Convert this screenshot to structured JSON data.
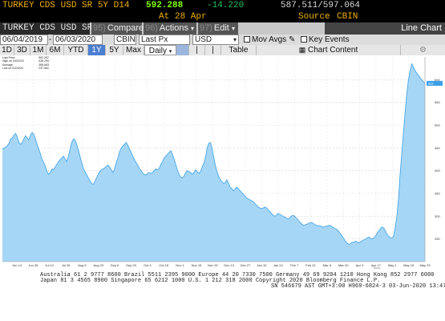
{
  "header": {
    "ticker": "TURKEY CDS USD SR 5Y D14",
    "price": "592.288",
    "change": "-14.220",
    "bid_ask": "587.511/597.064",
    "time_label": "At",
    "date": "28 Apr",
    "source_label": "Source",
    "source": "CBIN"
  },
  "toolbar": {
    "title": "TURKEY CDS USD SR",
    "compare_num": "95)",
    "compare_label": "Compare",
    "actions_num": "96)",
    "actions_label": "Actions",
    "edit_num": "97)",
    "edit_label": "Edit",
    "view_label": "Line Chart"
  },
  "fields": {
    "start_date": "06/04/2019",
    "end_date": "06/03/2020",
    "source_value": "CBIN",
    "price_type": "Last Px",
    "currency": "USD",
    "mov_avgs_label": "Mov Avgs",
    "key_events_label": "Key Events"
  },
  "periods": {
    "buttons": [
      "1D",
      "3D",
      "1M",
      "6M",
      "YTD",
      "1Y",
      "5Y",
      "Max"
    ],
    "selected": "1Y",
    "frequency": "Daily",
    "table_label": "Table",
    "chart_content_label": "Chart Content"
  },
  "legend": {
    "lines": [
      "Last Price",
      "High on 04/22/20",
      "Average",
      "Low on 01/24/20"
    ],
    "values": [
      "592.287",
      "635.294",
      "355.663",
      "237.661"
    ]
  },
  "footer": {
    "line1": "Australia 61 2 9777 8600 Brazil 5511 2395 9000 Europe 44 20 7330 7500 Germany 49 69 9204 1210 Hong Kong 852 2977 6000",
    "line2": "Japan 81 3 4565 8900      Singapore 65 6212 1000      U.S. 1 212 318 2000      Copyright 2020 Bloomberg Finance L.P.",
    "line3": "SN 546679 AST  GMT+3:00 H969-6824-3 03-Jun-2020 13:47:39"
  },
  "colors": {
    "price_up": "#7fff00",
    "price_down": "#20c060",
    "selected_period": "#4a7fd0",
    "area_fill": "#a6d6f5",
    "area_line": "#3aa0e6"
  },
  "chart_data": {
    "type": "area",
    "title": "",
    "xlabel": "",
    "ylabel": "",
    "ylim": [
      200,
      650
    ],
    "yticks": [
      250,
      300,
      350,
      400,
      450,
      500,
      550,
      600
    ],
    "xticks": [
      "Jun 14",
      "Jun 28",
      "Jul 12",
      "Jul 26",
      "Aug 9",
      "Aug 23",
      "Sep 6",
      "Sep 20",
      "Oct 4",
      "Oct 18",
      "Nov 1",
      "Nov 15",
      "Nov 29",
      "Dec 13",
      "Dec 27",
      "Jan 10",
      "Jan 24",
      "Feb 7",
      "Feb 21",
      "Mar 6",
      "Mar 20",
      "Apr 3",
      "Apr 17",
      "May 1",
      "May 15",
      "May 29"
    ],
    "grid": true,
    "series": [
      {
        "values": [
          447,
          450,
          452,
          455,
          460,
          470,
          472,
          478,
          482,
          474,
          462,
          458,
          462,
          470,
          477,
          472,
          468,
          478,
          484,
          480,
          470,
          458,
          448,
          438,
          425,
          418,
          410,
          398,
          392,
          396,
          404,
          402,
          408,
          414,
          420,
          424,
          428,
          432,
          426,
          420,
          432,
          448,
          462,
          470,
          468,
          458,
          446,
          432,
          418,
          406,
          398,
          392,
          384,
          378,
          372,
          370,
          376,
          384,
          392,
          398,
          402,
          404,
          406,
          410,
          412,
          408,
          402,
          396,
          404,
          418,
          428,
          442,
          450,
          454,
          458,
          462,
          456,
          448,
          440,
          432,
          424,
          418,
          412,
          405,
          400,
          395,
          392,
          390,
          394,
          396,
          394,
          396,
          400,
          404,
          402,
          405,
          414,
          420,
          428,
          432,
          436,
          440,
          444,
          436,
          426,
          414,
          402,
          392,
          386,
          384,
          388,
          396,
          400,
          398,
          396,
          392,
          396,
          402,
          398,
          394,
          398,
          408,
          416,
          428,
          450,
          460,
          462,
          450,
          430,
          412,
          398,
          388,
          380,
          376,
          372,
          374,
          380,
          372,
          364,
          360,
          356,
          360,
          364,
          360,
          356,
          352,
          348,
          344,
          340,
          338,
          336,
          334,
          332,
          328,
          324,
          320,
          318,
          316,
          318,
          320,
          318,
          314,
          310,
          306,
          302,
          300,
          302,
          306,
          304,
          302,
          300,
          298,
          296,
          294,
          296,
          300,
          302,
          300,
          296,
          292,
          288,
          284,
          281,
          280,
          282,
          283,
          285,
          286,
          285,
          282,
          280,
          279,
          279,
          278,
          276,
          276,
          278,
          278,
          280,
          279,
          276,
          274,
          272,
          270,
          265,
          260,
          255,
          250,
          244,
          240,
          238,
          240,
          243,
          242,
          245,
          243,
          241,
          244,
          246,
          248,
          250,
          252,
          254,
          251,
          250,
          252,
          256,
          262,
          268,
          272,
          276,
          274,
          268,
          260,
          256,
          253,
          252,
          256,
          276,
          300,
          340,
          395,
          440,
          485,
          530,
          570,
          600,
          620,
          635,
          628,
          620,
          615,
          610,
          605,
          600,
          596,
          592
        ]
      }
    ]
  }
}
